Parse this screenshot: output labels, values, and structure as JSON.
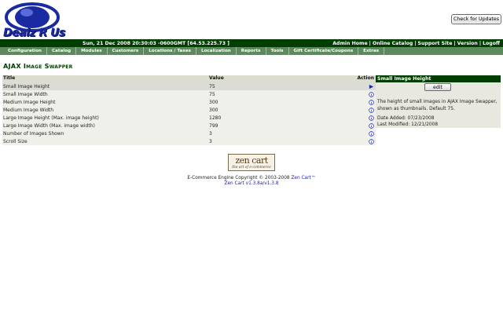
{
  "header": {
    "logo_text": "Dealz R Us",
    "update_button": "Check for Updates"
  },
  "statusbar": {
    "info": "Sun, 21 Dec 2008 20:30:03 -0600GMT [64.53.225.73 ]",
    "links": [
      "Admin Home",
      "Online Catalog",
      "Support Site",
      "Version",
      "Logoff"
    ]
  },
  "menu": [
    "Configuration",
    "Catalog",
    "Modules",
    "Customers",
    "Locations / Taxes",
    "Localization",
    "Reports",
    "Tools",
    "Gift Certificate/Coupons",
    "Extras"
  ],
  "page_title": "AJAX Image Swapper",
  "table": {
    "headers": {
      "title": "Title",
      "value": "Value",
      "action": "Action"
    },
    "rows": [
      {
        "title": "Small Image Height",
        "value": "75",
        "action": "arrow-icon"
      },
      {
        "title": "Small Image Width",
        "value": "75",
        "action": "info-icon"
      },
      {
        "title": "Medium Image Height",
        "value": "300",
        "action": "info-icon"
      },
      {
        "title": "Medium Image Width",
        "value": "300",
        "action": "info-icon"
      },
      {
        "title": "Large Image Height (Max. image height)",
        "value": "1280",
        "action": "info-icon"
      },
      {
        "title": "Large Image Width (Max. image width)",
        "value": "799",
        "action": "info-icon"
      },
      {
        "title": "Number of Images Shown",
        "value": "3",
        "action": "info-icon"
      },
      {
        "title": "Scroll Size",
        "value": "3",
        "action": "info-icon"
      }
    ]
  },
  "sidebox": {
    "heading": "Small Image Height",
    "edit_button": "edit",
    "description": "The height of small images in AJAX Image Swapper, shown as thumbnails. Default 75.",
    "date_added": "Date Added: 07/23/2008",
    "last_modified": "Last Modified: 12/21/2008"
  },
  "footer": {
    "zen_logo": "zen cart",
    "zen_tagline": "the art of e-commerce",
    "copyright_prefix": "E-Commerce Engine Copyright © 2003-2008 ",
    "copyright_link": "Zen Cart™",
    "version": "Zen Cart v1.3.8a/v1.3.8"
  },
  "colors": {
    "statusbar": "#003d00",
    "menubar": "#5d8a5d",
    "logo_blue": "#1a2aa0",
    "link_blue": "#1a1aa8"
  }
}
